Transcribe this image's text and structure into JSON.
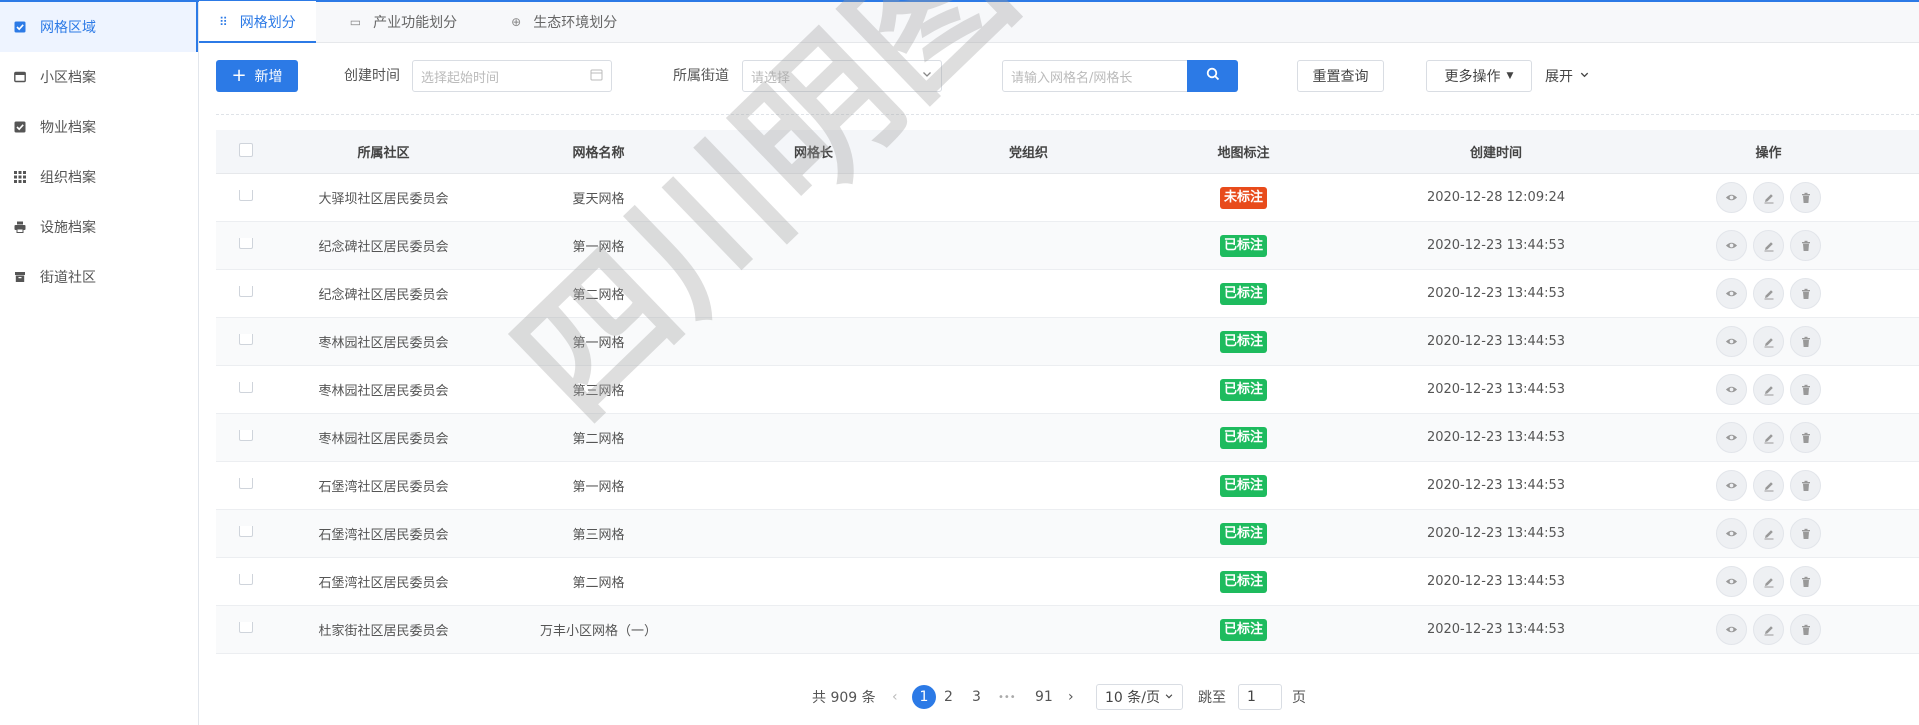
{
  "sidebar": {
    "items": [
      {
        "label": "网格区域",
        "icon": "check-square-icon",
        "active": true
      },
      {
        "label": "小区档案",
        "icon": "window-icon",
        "active": false
      },
      {
        "label": "物业档案",
        "icon": "check-square-icon",
        "active": false
      },
      {
        "label": "组织档案",
        "icon": "grid-dots-icon",
        "active": false
      },
      {
        "label": "设施档案",
        "icon": "printer-icon",
        "active": false
      },
      {
        "label": "街道社区",
        "icon": "archive-icon",
        "active": false
      }
    ]
  },
  "tabs": [
    {
      "label": "网格划分",
      "icon": "grid-dots-icon",
      "active": true
    },
    {
      "label": "产业功能划分",
      "icon": "folder-icon",
      "active": false
    },
    {
      "label": "生态环境划分",
      "icon": "circle-plus-icon",
      "active": false
    }
  ],
  "toolbar": {
    "add_label": "新增",
    "created_time_label": "创建时间",
    "created_time_placeholder": "选择起始时间",
    "street_label": "所属街道",
    "street_placeholder": "请选择",
    "search_placeholder": "请输入网格名/网格长",
    "reset_label": "重置查询",
    "more_label": "更多操作",
    "expand_label": "展开"
  },
  "table": {
    "columns": [
      "所属社区",
      "网格名称",
      "网格长",
      "党组织",
      "地图标注",
      "创建时间",
      "操作"
    ],
    "rows": [
      {
        "community": "大驿坝社区居民委员会",
        "grid": "夏天网格",
        "leader": "",
        "party": "",
        "tag": "未标注",
        "tag_color": "#e84b1b",
        "time": "2020-12-28 12:09:24"
      },
      {
        "community": "纪念碑社区居民委员会",
        "grid": "第一网格",
        "leader": "",
        "party": "",
        "tag": "已标注",
        "tag_color": "#1ebb5e",
        "time": "2020-12-23 13:44:53"
      },
      {
        "community": "纪念碑社区居民委员会",
        "grid": "第二网格",
        "leader": "",
        "party": "",
        "tag": "已标注",
        "tag_color": "#1ebb5e",
        "time": "2020-12-23 13:44:53"
      },
      {
        "community": "枣林园社区居民委员会",
        "grid": "第一网格",
        "leader": "",
        "party": "",
        "tag": "已标注",
        "tag_color": "#1ebb5e",
        "time": "2020-12-23 13:44:53"
      },
      {
        "community": "枣林园社区居民委员会",
        "grid": "第三网格",
        "leader": "",
        "party": "",
        "tag": "已标注",
        "tag_color": "#1ebb5e",
        "time": "2020-12-23 13:44:53"
      },
      {
        "community": "枣林园社区居民委员会",
        "grid": "第二网格",
        "leader": "",
        "party": "",
        "tag": "已标注",
        "tag_color": "#1ebb5e",
        "time": "2020-12-23 13:44:53"
      },
      {
        "community": "石堡湾社区居民委员会",
        "grid": "第一网格",
        "leader": "",
        "party": "",
        "tag": "已标注",
        "tag_color": "#1ebb5e",
        "time": "2020-12-23 13:44:53"
      },
      {
        "community": "石堡湾社区居民委员会",
        "grid": "第三网格",
        "leader": "",
        "party": "",
        "tag": "已标注",
        "tag_color": "#1ebb5e",
        "time": "2020-12-23 13:44:53"
      },
      {
        "community": "石堡湾社区居民委员会",
        "grid": "第二网格",
        "leader": "",
        "party": "",
        "tag": "已标注",
        "tag_color": "#1ebb5e",
        "time": "2020-12-23 13:44:53"
      },
      {
        "community": "杜家街社区居民委员会",
        "grid": "万丰小区网格（一）",
        "leader": "",
        "party": "",
        "tag": "已标注",
        "tag_color": "#1ebb5e",
        "time": "2020-12-23 13:44:53"
      }
    ]
  },
  "pagination": {
    "total_label": "共 909 条",
    "pages": [
      "1",
      "2",
      "3"
    ],
    "ellipsis": "•••",
    "last_page": "91",
    "current": "1",
    "page_size_label": "10 条/页",
    "jump_label": "跳至",
    "jump_value": "1",
    "page_unit": "页"
  },
  "watermark": "四川明图科技 scmintu.com",
  "colors": {
    "accent": "#2c7ae6",
    "tag_unmarked": "#e84b1b",
    "tag_marked": "#1ebb5e"
  }
}
